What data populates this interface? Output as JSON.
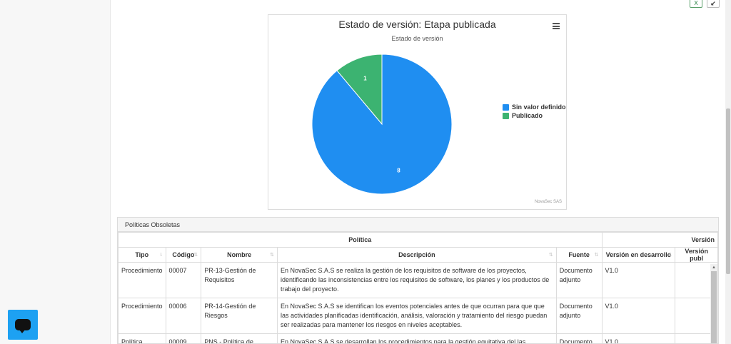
{
  "chart": {
    "title": "Estado de versión: Etapa publicada",
    "subtitle": "Estado de versión",
    "credits": "NovaSec SAS"
  },
  "chart_data": {
    "type": "pie",
    "title": "Estado de versión: Etapa publicada",
    "subtitle": "Estado de versión",
    "categories": [
      "Sin valor definido",
      "Publicado"
    ],
    "values": [
      8,
      1
    ],
    "colors": [
      "#1f8ef1",
      "#3cb371"
    ],
    "data_labels": [
      "8",
      "1"
    ],
    "legend_position": "right"
  },
  "toolbar": {
    "export_icon": "excel-export-icon",
    "collapse_icon": "collapse-arrow-icon",
    "export_glyph": "X",
    "collapse_glyph": "↙"
  },
  "panel": {
    "heading": "Políticas Obsoletas",
    "group_headers": [
      "Política",
      "Versión"
    ],
    "columns": [
      "Tipo",
      "Código",
      "Nombre",
      "Descripción",
      "Fuente",
      "Versión en desarrollo",
      "Versión publ"
    ],
    "rows": [
      {
        "tipo": "Procedimiento",
        "codigo": "00007",
        "nombre": "PR-13-Gestión de Requisitos",
        "descripcion": "En NovaSec S.A.S se realiza la gestión de los requisitos de software de los proyectos, identificando las inconsistencias entre los requisitos de software, los planes y los productos de trabajo del proyecto.",
        "fuente": "Documento adjunto",
        "version_desarrollo": "V1.0",
        "version_publicada": ""
      },
      {
        "tipo": "Procedimiento",
        "codigo": "00006",
        "nombre": "PR-14-Gestión de Riesgos",
        "descripcion": "En NovaSec S.A.S se identifican los eventos potenciales antes de que ocurran para que que las actividades planificadas identificación, análisis, valoración y tratamiento del riesgo puedan ser realizadas para mantener los riesgos en niveles aceptables.",
        "fuente": "Documento adjunto",
        "version_desarrollo": "V1.0",
        "version_publicada": ""
      },
      {
        "tipo": "Política",
        "codigo": "00009",
        "nombre": "PNS - Política de gestión de canales",
        "descripcion": "En NovaSec S.A.S se desarrollan los procedimientos para la gestión equitativa del las actividades de los canales",
        "fuente": "Documento adjunto",
        "version_desarrollo": "V1.0",
        "version_publicada": ""
      }
    ]
  },
  "chat": {
    "icon": "chat-bubble-icon"
  }
}
